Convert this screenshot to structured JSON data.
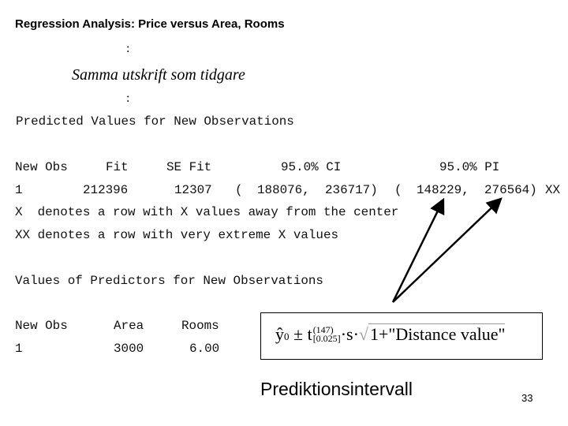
{
  "title": "Regression Analysis: Price versus Area, Rooms",
  "ellipsis_top": ":",
  "note_italic": "Samma utskrift som tidgare",
  "ellipsis_bottom": ":",
  "predicted_section": {
    "heading": "Predicted Values for New Observations",
    "columns": [
      "New Obs",
      "Fit",
      "SE Fit",
      "95.0% CI",
      "95.0% PI"
    ],
    "row": {
      "new_obs": "1",
      "fit": "212396",
      "se_fit": "12307",
      "ci_open": "(",
      "ci_low": "188076,",
      "ci_high": "236717)",
      "pi_open": "(",
      "pi_low": "148229,",
      "pi_high": "276564)",
      "flag": "XX"
    },
    "legend": [
      "X  denotes a row with X values away from the center",
      "XX denotes a row with very extreme X values"
    ]
  },
  "predictors_section": {
    "heading": "Values of Predictors for New Observations",
    "columns": [
      "New Obs",
      "Area",
      "Rooms"
    ],
    "row": [
      "1",
      "3000",
      "6.00"
    ]
  },
  "formula": {
    "yhat": "ŷ",
    "yhat_sub": "0",
    "pm": " ± t",
    "df": "(147)",
    "alpha": "[0.025]",
    "dot_s": "·s·",
    "sqrt_sign": "√",
    "radicand": "1+\"Distance value\""
  },
  "caption": "Prediktionsintervall",
  "page_number": "33"
}
